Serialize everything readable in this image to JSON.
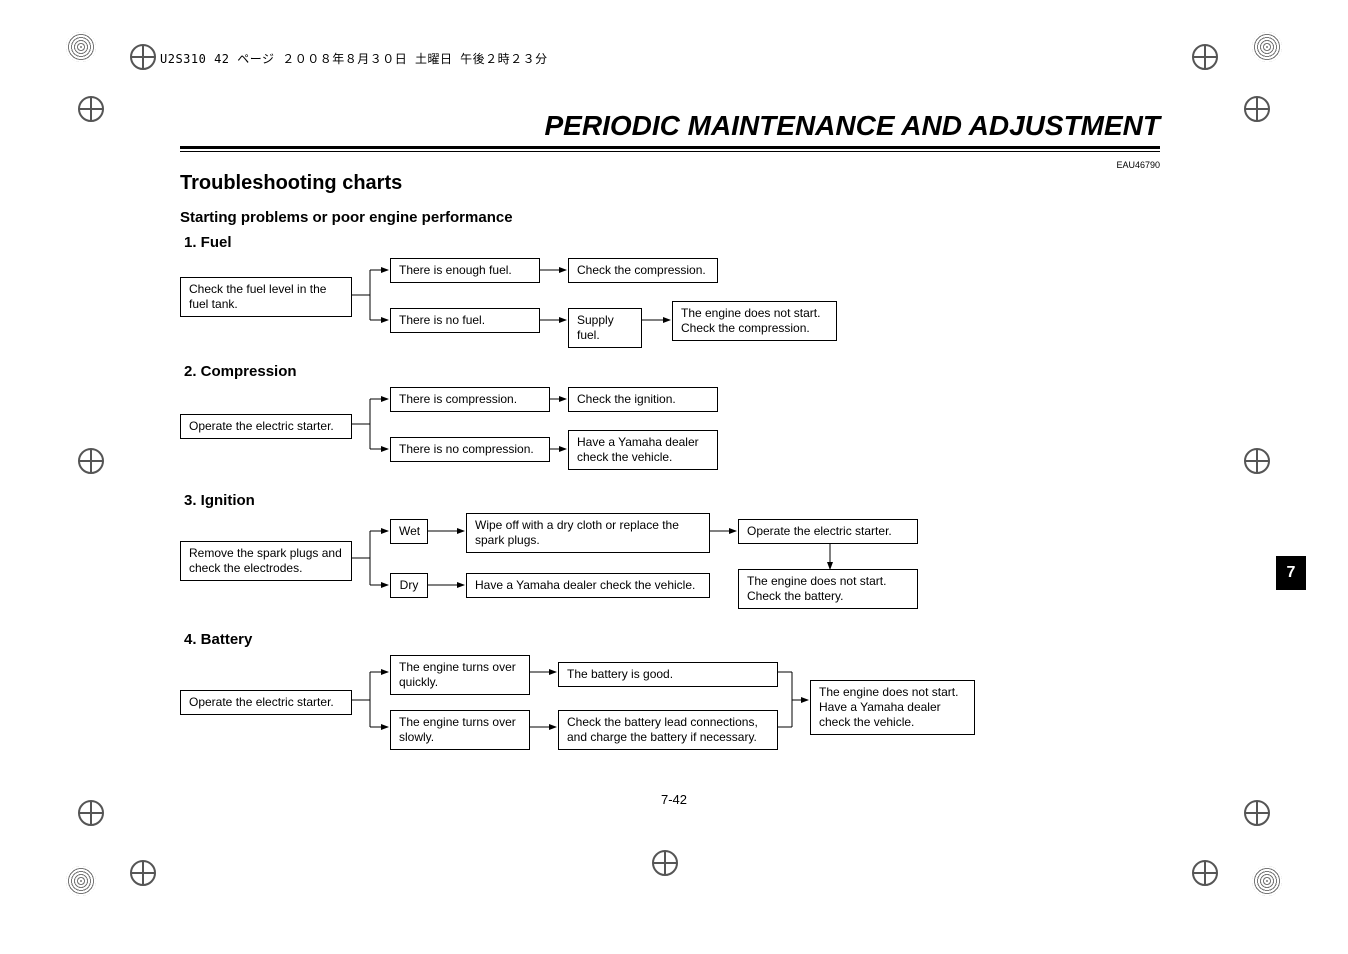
{
  "header_strip": "U2S310 42 ページ  ２００８年８月３０日  土曜日  午後２時２３分",
  "chapter_title": "PERIODIC MAINTENANCE AND ADJUSTMENT",
  "doc_code": "EAU46790",
  "section_title": "Troubleshooting charts",
  "subsection_title": "Starting problems or poor engine performance",
  "page_number": "7-42",
  "side_tab": "7",
  "blocks": {
    "fuel": {
      "title": "1. Fuel",
      "start": "Check the fuel level in the fuel tank.",
      "optA": "There is enough fuel.",
      "optA_next": "Check the compression.",
      "optB": "There is no fuel.",
      "optB_next": "Supply fuel.",
      "optB_result": "The engine does not start. Check the compression."
    },
    "compression": {
      "title": "2. Compression",
      "start": "Operate the electric starter.",
      "optA": "There is compression.",
      "optA_next": "Check the ignition.",
      "optB": "There is no compression.",
      "optB_next": "Have a Yamaha dealer check the vehicle."
    },
    "ignition": {
      "title": "3. Ignition",
      "start": "Remove the spark plugs and check the electrodes.",
      "optA": "Wet",
      "optA_next": "Wipe off with a dry cloth or replace the spark plugs.",
      "optA_next2": "Operate the electric starter.",
      "optB": "Dry",
      "optB_next": "Have a Yamaha dealer check the vehicle.",
      "result": "The engine does not start. Check the battery."
    },
    "battery": {
      "title": "4. Battery",
      "start": "Operate the electric starter.",
      "optA": "The engine turns over quickly.",
      "optA_next": "The battery is good.",
      "optB": "The engine turns over slowly.",
      "optB_next": "Check the battery lead connections, and charge the battery if necessary.",
      "result": "The engine does not start. Have a Yamaha dealer check the vehicle."
    }
  }
}
